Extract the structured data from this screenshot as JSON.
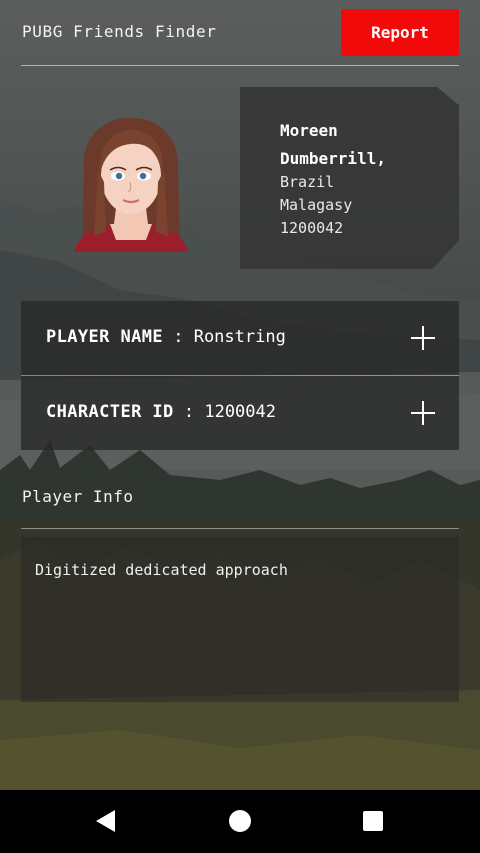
{
  "app": {
    "title": "PUBG Friends Finder",
    "report_label": "Report"
  },
  "profile": {
    "name": "Moreen Dumberrill,",
    "country": "Brazil",
    "language": "Malagasy",
    "id": "1200042"
  },
  "fields": [
    {
      "label": "PLAYER NAME",
      "separator": " : ",
      "value": "Ronstring"
    },
    {
      "label": "CHARACTER ID",
      "separator": " : ",
      "value": "1200042"
    }
  ],
  "player_info": {
    "title": "Player Info",
    "text": "Digitized dedicated approach"
  },
  "colors": {
    "accent": "#f20a0a",
    "card": "#343434"
  }
}
